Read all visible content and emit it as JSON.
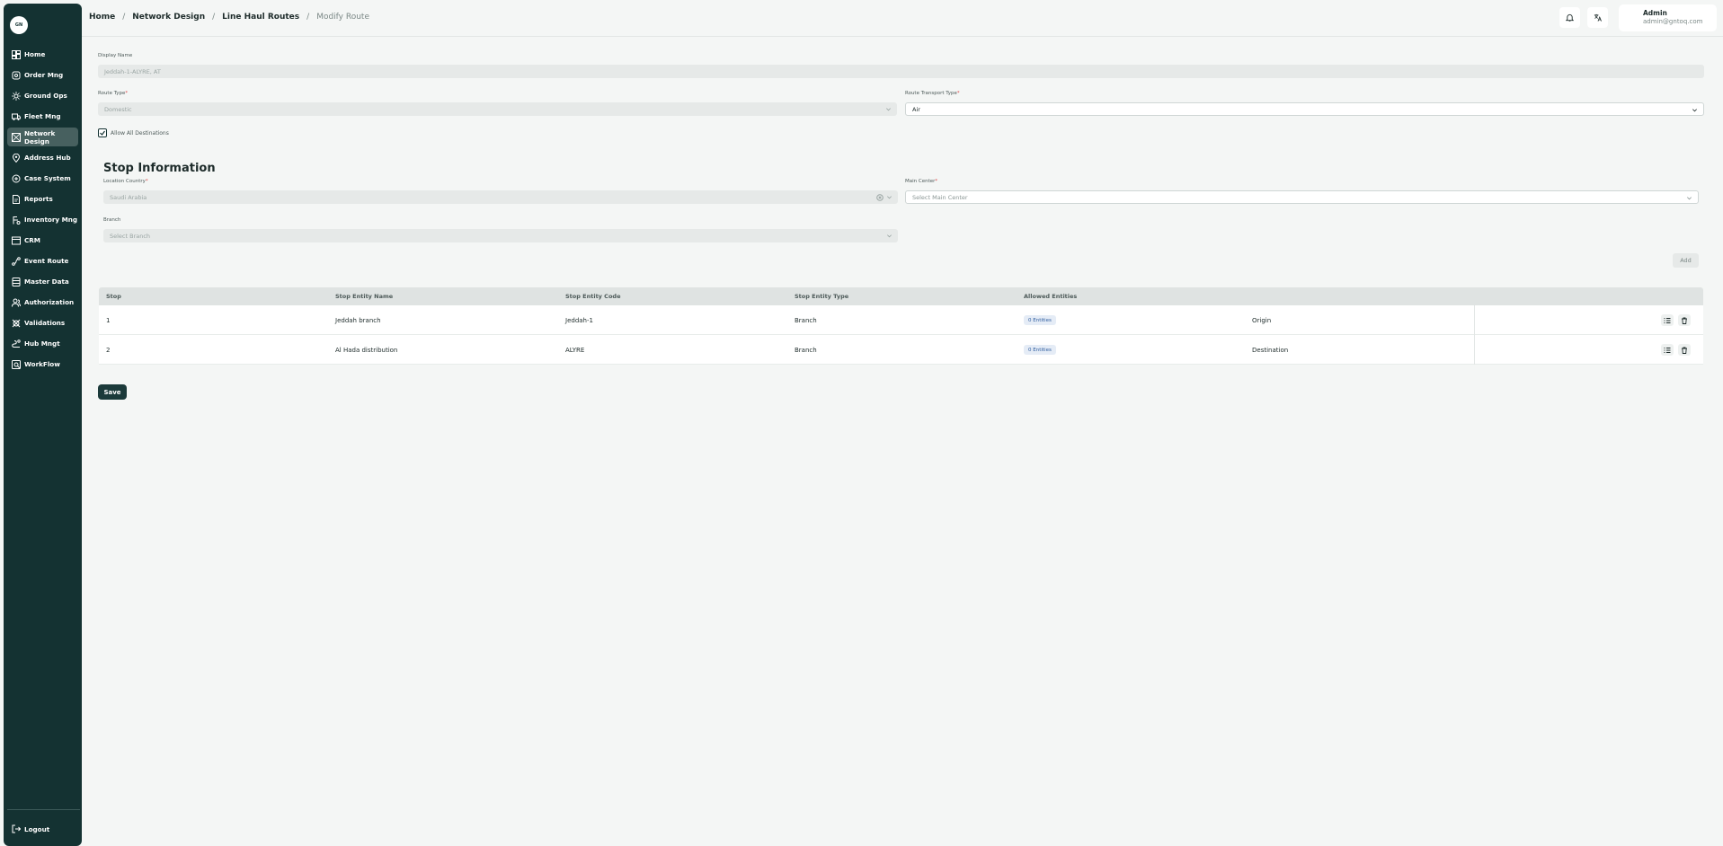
{
  "app": {
    "logo_text": "GN"
  },
  "sidebar": {
    "items": [
      {
        "label": "Home",
        "icon": "dashboard-icon"
      },
      {
        "label": "Order Mng",
        "icon": "order-icon"
      },
      {
        "label": "Ground Ops",
        "icon": "ground-ops-icon"
      },
      {
        "label": "Fleet Mng",
        "icon": "truck-icon"
      },
      {
        "label": "Network Design",
        "icon": "network-icon",
        "active": true
      },
      {
        "label": "Address Hub",
        "icon": "location-icon"
      },
      {
        "label": "Case System",
        "icon": "case-icon"
      },
      {
        "label": "Reports",
        "icon": "report-icon"
      },
      {
        "label": "Inventory Mng",
        "icon": "inventory-icon"
      },
      {
        "label": "CRM",
        "icon": "crm-icon"
      },
      {
        "label": "Event Route",
        "icon": "route-icon"
      },
      {
        "label": "Master Data",
        "icon": "database-icon"
      },
      {
        "label": "Authorization",
        "icon": "users-icon"
      },
      {
        "label": "Validations",
        "icon": "validation-icon"
      },
      {
        "label": "Hub Mngt",
        "icon": "hub-icon"
      },
      {
        "label": "WorkFlow",
        "icon": "workflow-icon"
      }
    ],
    "logout_label": "Logout"
  },
  "breadcrumb": [
    "Home",
    "Network Design",
    "Line Haul Routes",
    "Modify Route"
  ],
  "user": {
    "name": "Admin",
    "email": "admin@gntoq.com"
  },
  "form": {
    "display_name": {
      "label": "Display Name",
      "value": "Jeddah-1-ALYRE, AT"
    },
    "route_type": {
      "label": "Route Type",
      "value": "Domestic"
    },
    "route_transport_type": {
      "label": "Route Transport Type",
      "value": "Air"
    },
    "allow_all_destinations": {
      "label": "Allow All Destinations",
      "checked": true
    }
  },
  "stop_info": {
    "title": "Stop Information",
    "location_country": {
      "label": "Location Country",
      "value": "Saudi Arabia"
    },
    "main_center": {
      "label": "Main Center",
      "placeholder": "Select Main Center"
    },
    "branch": {
      "label": "Branch",
      "placeholder": "Select Branch"
    },
    "add_label": "Add"
  },
  "table": {
    "headers": [
      "Stop",
      "Stop Entity Name",
      "Stop Entity Code",
      "Stop Entity Type",
      "Allowed Entities"
    ],
    "rows": [
      {
        "stop": "1",
        "name": "Jeddah branch",
        "code": "Jeddah-1",
        "type": "Branch",
        "allowed": "0 Entities",
        "role": "Origin"
      },
      {
        "stop": "2",
        "name": "Al Hada distribution",
        "code": "ALYRE",
        "type": "Branch",
        "allowed": "0 Entities",
        "role": "Destination"
      }
    ]
  },
  "save_label": "Save",
  "colors": {
    "sidebar": "#143232",
    "active_nav": "#47605f",
    "primary_button": "#1b3a3a",
    "badge": "#e5ecf6"
  }
}
